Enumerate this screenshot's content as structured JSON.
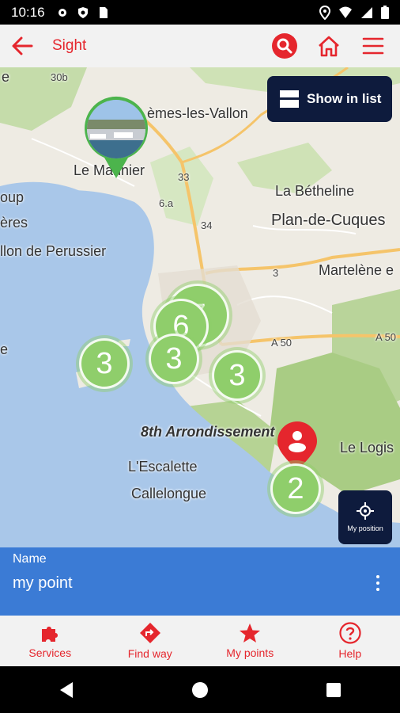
{
  "status": {
    "time": "10:16"
  },
  "appbar": {
    "title": "Sight"
  },
  "map": {
    "show_list_label": "Show in list",
    "my_position_label": "My position",
    "labels": {
      "e_top": "e",
      "road_30b": "30b",
      "vallon": "èmes-les-Vallon",
      "le_mannier": "Le Mannier",
      "road_33": "33",
      "road_6a": "6.a",
      "road_34": "34",
      "road_3": "3",
      "la_betheline": "La Bétheline",
      "plan_de_cuques": "Plan-de-Cuques",
      "oup": "oup",
      "eres": "ères",
      "perussier": "llon de Perussier",
      "martelene": "Martelène e",
      "a50": "A 50",
      "a50b": "A 50",
      "e_left": "e",
      "arrondissement": "8th Arrondissement",
      "escalette": "L'Escalette",
      "le_logis": "Le Logis",
      "callelongue": "Callelongue"
    },
    "clusters": [
      "7",
      "6",
      "3",
      "3",
      "3",
      "2"
    ]
  },
  "info": {
    "name_label": "Name",
    "name_value": "my point"
  },
  "tabs": {
    "services": "Services",
    "find_way": "Find way",
    "my_points": "My points",
    "help": "Help"
  },
  "colors": {
    "accent": "#e5262d",
    "panel": "#3b7bd5",
    "dark": "#0e1b3d",
    "cluster": "#8fce6b"
  }
}
